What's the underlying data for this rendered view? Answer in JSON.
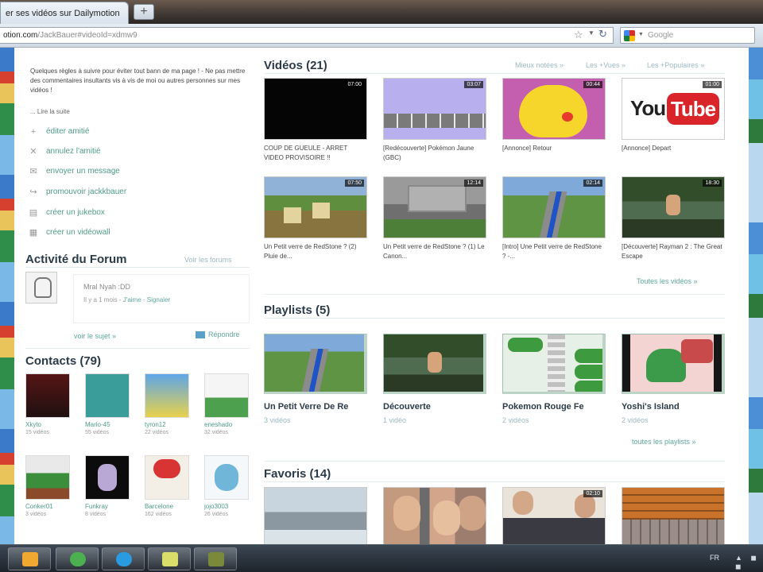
{
  "browser": {
    "tab_title": "er ses vidéos sur Dailymotion",
    "new_tab_symbol": "+",
    "url_host": "otion.com",
    "url_path": "/JackBauer#videoId=xdmw9",
    "search_placeholder": "Google",
    "icons": [
      "bookmark-star-icon",
      "reload-icon",
      "google-icon",
      "new-tab-icon"
    ]
  },
  "sidebar": {
    "rules_text": "Quelques règles à suivre pour éviter tout bann de ma page ! - Ne pas mettre des commentaires insultants vis à vis de moi ou autres personnes sur mes vidéos !",
    "read_more": "... Lire la suite",
    "actions": [
      {
        "label": "éditer amitié",
        "icon": "plus-icon",
        "glyph": "+"
      },
      {
        "label": "annulez l'amitié",
        "icon": "close-icon",
        "glyph": "✕"
      },
      {
        "label": "envoyer un message",
        "icon": "mail-icon",
        "glyph": "✉"
      },
      {
        "label": "promouvoir jackkbauer",
        "icon": "promote-icon",
        "glyph": "↪"
      },
      {
        "label": "créer un jukebox",
        "icon": "jukebox-icon",
        "glyph": "▤"
      },
      {
        "label": "créer un vidéowall",
        "icon": "videowall-icon",
        "glyph": "▦"
      }
    ],
    "forum": {
      "title": "Activité du Forum",
      "view_all": "Voir les forums",
      "message": "Mral Nyah :DD",
      "time": "Il y a 1 mois - ",
      "like": "J'aime",
      "separator": " - ",
      "report": "Signaler",
      "view_topic": "voir le sujet »",
      "reply": "Répondre"
    },
    "contacts": {
      "title": "Contacts (79)",
      "items": [
        {
          "name": "Xkyto",
          "count": "15 vidéos"
        },
        {
          "name": "Mario-45",
          "count": "55 vidéos"
        },
        {
          "name": "tyron12",
          "count": "22 vidéos"
        },
        {
          "name": "eneshado",
          "count": "32 vidéos"
        },
        {
          "name": "Conker01",
          "count": "3 vidéos"
        },
        {
          "name": "Funkray",
          "count": "8 vidéos"
        },
        {
          "name": "Barcelone",
          "count": "162 vidéos"
        },
        {
          "name": "jojo3003",
          "count": "26 vidéos"
        }
      ]
    }
  },
  "videos": {
    "title": "Vidéos (21)",
    "sort_links": [
      "Mieux notées »",
      "Les +Vues »",
      "Les +Populaires »"
    ],
    "all_link": "Toutes les vidéos »",
    "items": [
      {
        "title": "COUP DE GUEULE - ARRET VIDEO PROVISOIRE !!",
        "duration": "07:00"
      },
      {
        "title": "[Redécouverte] Pokémon Jaune (GBC)",
        "duration": "03:07"
      },
      {
        "title": "[Annonce] Retour",
        "duration": "00:44"
      },
      {
        "title": "[Annonce] Depart",
        "duration": "01:00"
      },
      {
        "title": "Un Petit verre de RedStone ? (2) Pluie de...",
        "duration": "07:50"
      },
      {
        "title": "Un Petit verre de RedStone ? (1) Le Canon...",
        "duration": "12:14"
      },
      {
        "title": "[Intro] Une Petit verre de RedStone ? -...",
        "duration": "02:14"
      },
      {
        "title": "[Découverte] Rayman 2 : The Great Escape",
        "duration": "18:30"
      }
    ],
    "youtube_logo": {
      "you": "You",
      "tube": "Tube"
    }
  },
  "playlists": {
    "title": "Playlists (5)",
    "all_link": "toutes les playlists »",
    "items": [
      {
        "title": "Un Petit Verre De Re",
        "count": "3 vidéos"
      },
      {
        "title": "Découverte",
        "count": "1 vidéo"
      },
      {
        "title": "Pokemon Rouge Fe",
        "count": "2 vidéos"
      },
      {
        "title": "Yoshi's Island",
        "count": "2 vidéos"
      }
    ]
  },
  "favorites": {
    "title": "Favoris (14)",
    "items": [
      {
        "duration": ""
      },
      {
        "duration": ""
      },
      {
        "duration": "02:10"
      },
      {
        "duration": ""
      }
    ]
  },
  "taskbar": {
    "items": [
      "media-player-icon",
      "messenger-icon",
      "skype-icon",
      "sticky-notes-icon",
      "app-icon"
    ],
    "language": "FR",
    "tray": "▲ ◼ ◼"
  }
}
